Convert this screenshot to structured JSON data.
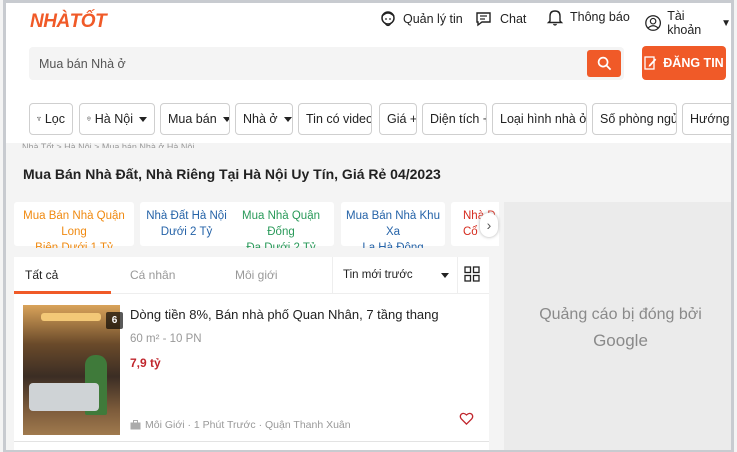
{
  "header": {
    "logo": "NHÀTỐT",
    "nav": [
      {
        "label": "Quản lý tin",
        "icon": "manager-icon"
      },
      {
        "label": "Chat",
        "icon": "chat-icon"
      },
      {
        "label": "Thông báo",
        "icon": "bell-icon"
      },
      {
        "label": "Tài khoản",
        "icon": "account-icon"
      }
    ]
  },
  "search": {
    "placeholder": "Mua bán Nhà ở",
    "button_icon": "search-icon"
  },
  "post_button": {
    "label": "ĐĂNG TIN",
    "icon": "edit-icon"
  },
  "filters": [
    {
      "label": "Lọc",
      "icon": "filter-icon"
    },
    {
      "label": "Hà Nội",
      "icon": "location-icon",
      "dropdown": true
    },
    {
      "label": "Mua bán",
      "dropdown": true
    },
    {
      "label": "Nhà ở",
      "dropdown": true
    },
    {
      "label": "Tin có video +"
    },
    {
      "label": "Giá +"
    },
    {
      "label": "Diện tích +"
    },
    {
      "label": "Loại hình nhà ở +"
    },
    {
      "label": "Số phòng ngủ +"
    },
    {
      "label": "Hướng cửa"
    }
  ],
  "breadcrumb": "Nhà Tốt > Hà Nội > Mua bán Nhà ở Hà Nội",
  "page_title": "Mua Bán Nhà Đất, Nhà Riêng Tại Hà Nội Uy Tín, Giá Rẻ 04/2023",
  "categories": [
    {
      "line1": "Mua Bán Nhà Quận Long",
      "line2": "Biên Dưới 1 Tỷ"
    },
    {
      "line1": "Nhà Đất Hà Nội",
      "line2": "Dưới 2 Tỷ"
    },
    {
      "line1": "Mua Nhà Quận Đống",
      "line2": "Đa Dưới 2 Tỷ"
    },
    {
      "line1": "Mua Bán Nhà Khu Xa",
      "line2": "La Hà Đông"
    },
    {
      "line1": "Nhà Đ",
      "line2": "Cổ"
    }
  ],
  "tabs": [
    {
      "label": "Tất cả",
      "active": true
    },
    {
      "label": "Cá nhân",
      "active": false
    },
    {
      "label": "Môi giới",
      "active": false
    }
  ],
  "sort": {
    "selected": "Tin mới trước"
  },
  "listing": {
    "image_count": "6",
    "title": "Dòng tiền 8%, Bán nhà phố Quan Nhân, 7 tầng thang",
    "meta": "60 m² - 10 PN",
    "price": "7,9 tỷ",
    "footer": "Môi Giới · 1 Phút Trước · Quận Thanh Xuân"
  },
  "ad": {
    "line1": "Quảng cáo bị đóng bởi",
    "line2": "Google"
  },
  "colors": {
    "accent": "#f05a28",
    "price": "#c0262d",
    "category_green": "#2a9a5a",
    "category_orange": "#f08a10",
    "category_blue": "#2563a8"
  }
}
